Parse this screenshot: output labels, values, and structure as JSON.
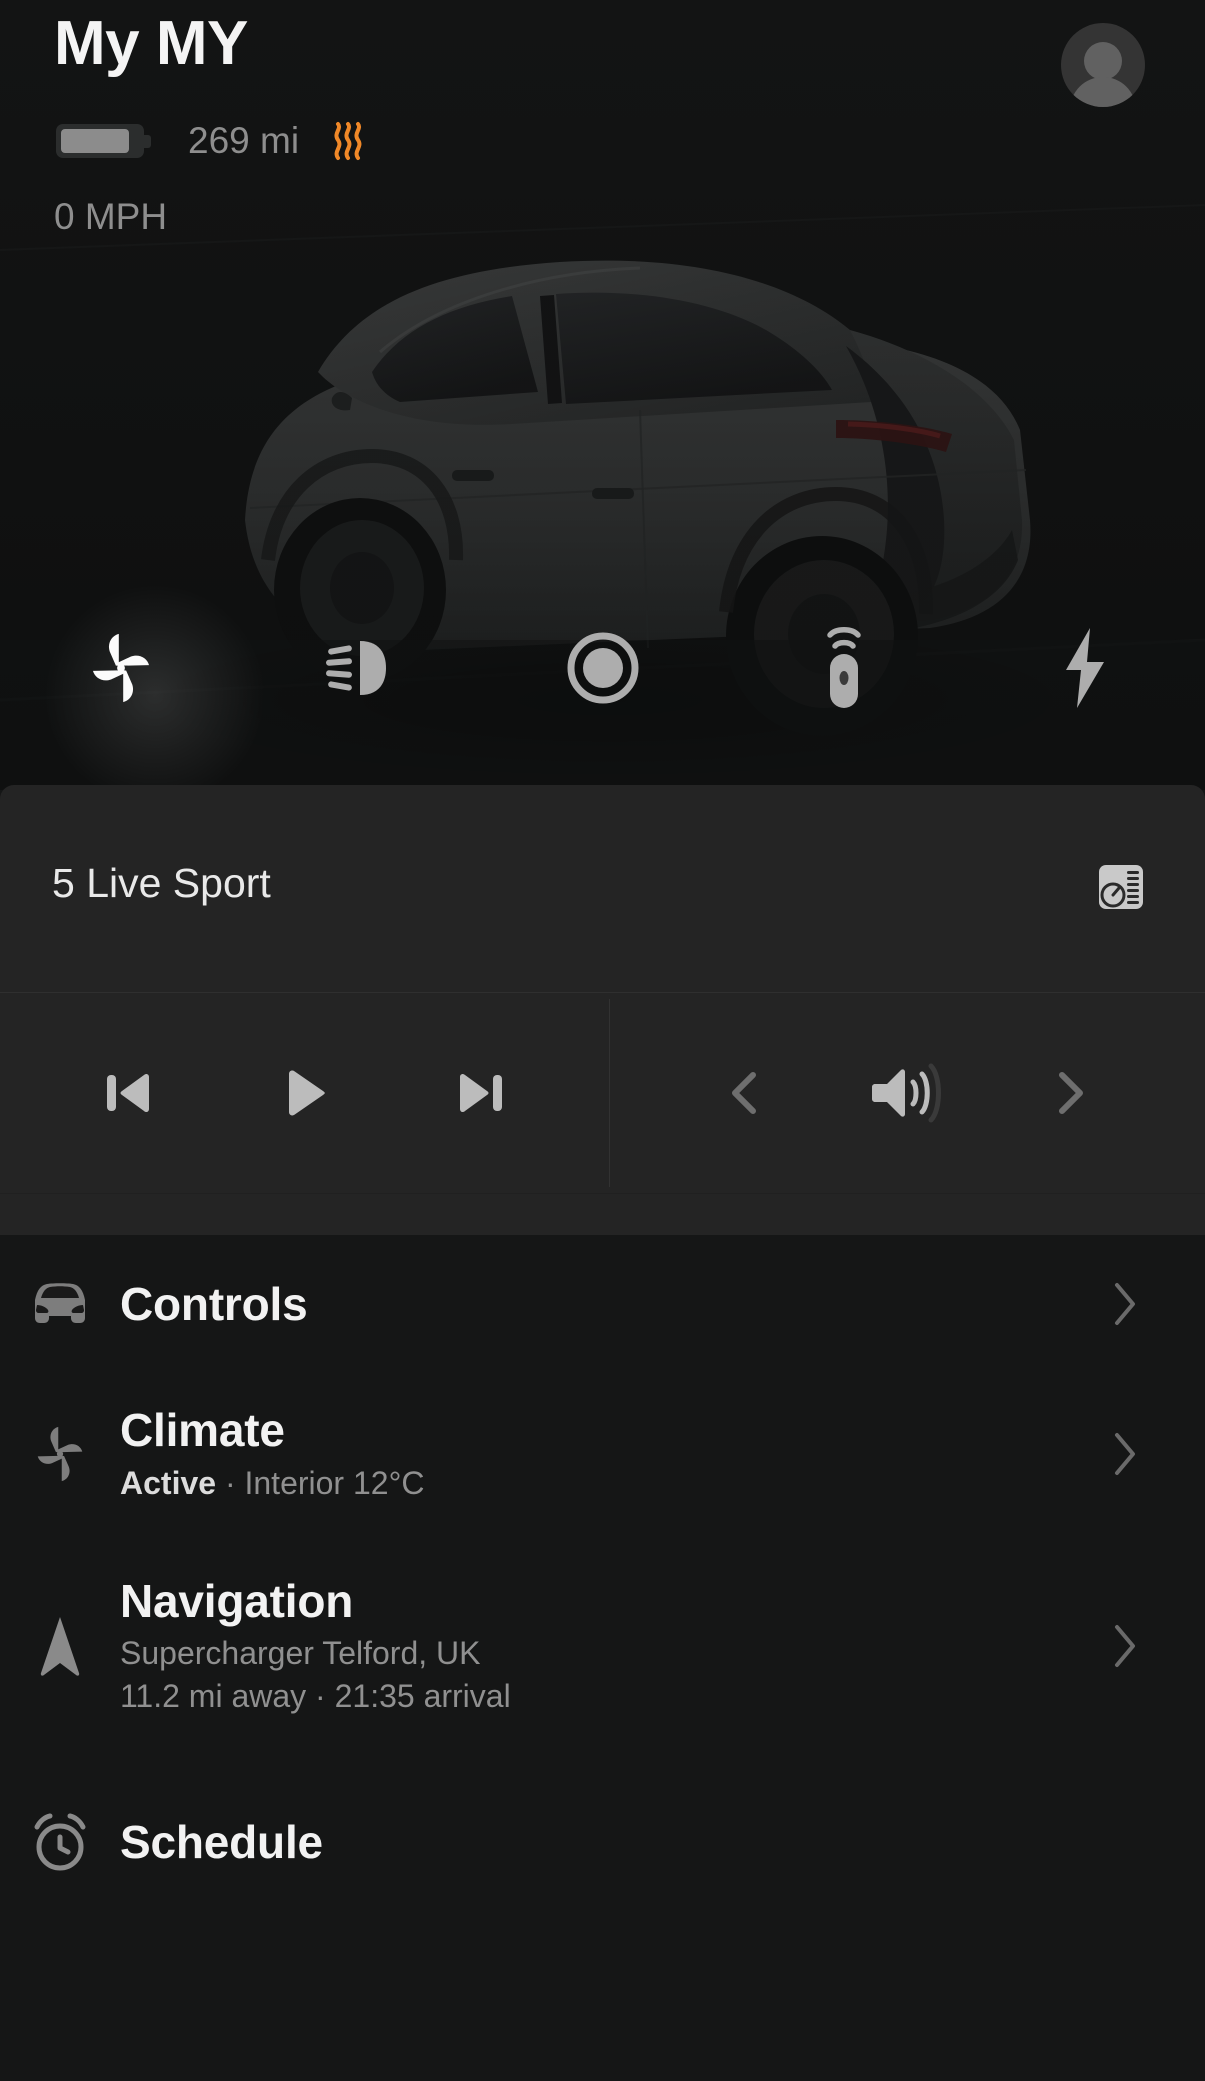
{
  "header": {
    "title": "My MY",
    "range": "269 mi",
    "speed": "0 MPH",
    "battery_icon": "battery-icon",
    "heat_icon": "heat-waves-icon",
    "avatar_icon": "account-avatar-icon"
  },
  "car_actions": [
    {
      "name": "fan-icon",
      "label": "Climate fan",
      "active": true
    },
    {
      "name": "headlights-icon",
      "label": "Headlights",
      "active": false
    },
    {
      "name": "lock-icon",
      "label": "Lock",
      "active": false
    },
    {
      "name": "keyfob-icon",
      "label": "Remote key",
      "active": false
    },
    {
      "name": "charge-bolt-icon",
      "label": "Charging",
      "active": false
    }
  ],
  "media": {
    "title": "5 Live Sport",
    "source_icon": "radio-tuner-icon",
    "transport": [
      {
        "name": "previous-track-button",
        "label": "Previous"
      },
      {
        "name": "play-button",
        "label": "Play"
      },
      {
        "name": "next-track-button",
        "label": "Next"
      }
    ],
    "volume": [
      {
        "name": "volume-down-button",
        "label": "Volume down"
      },
      {
        "name": "volume-icon",
        "label": "Volume"
      },
      {
        "name": "volume-up-button",
        "label": "Volume up"
      }
    ]
  },
  "menu": [
    {
      "key": "controls",
      "label": "Controls",
      "icon": "car-front-icon",
      "sub_prefix": "",
      "sub": "",
      "sub2": ""
    },
    {
      "key": "climate",
      "label": "Climate",
      "icon": "fan-icon",
      "sub_prefix": "Active",
      "sub": " · Interior 12°C",
      "sub2": ""
    },
    {
      "key": "navigation",
      "label": "Navigation",
      "icon": "navigation-arrow-icon",
      "sub_prefix": "",
      "sub": "Supercharger Telford, UK",
      "sub2": "11.2 mi away  ·  21:35 arrival"
    },
    {
      "key": "schedule",
      "label": "Schedule",
      "icon": "alarm-clock-icon",
      "sub_prefix": "",
      "sub": "",
      "sub2": ""
    }
  ],
  "colors": {
    "background": "#151616",
    "hero_background": "#111212",
    "card_background": "#242424",
    "accent_heat": "#f08828",
    "icon_grey": "#b9b9b9",
    "text_primary": "#f2f2f2",
    "text_secondary": "#909090"
  }
}
